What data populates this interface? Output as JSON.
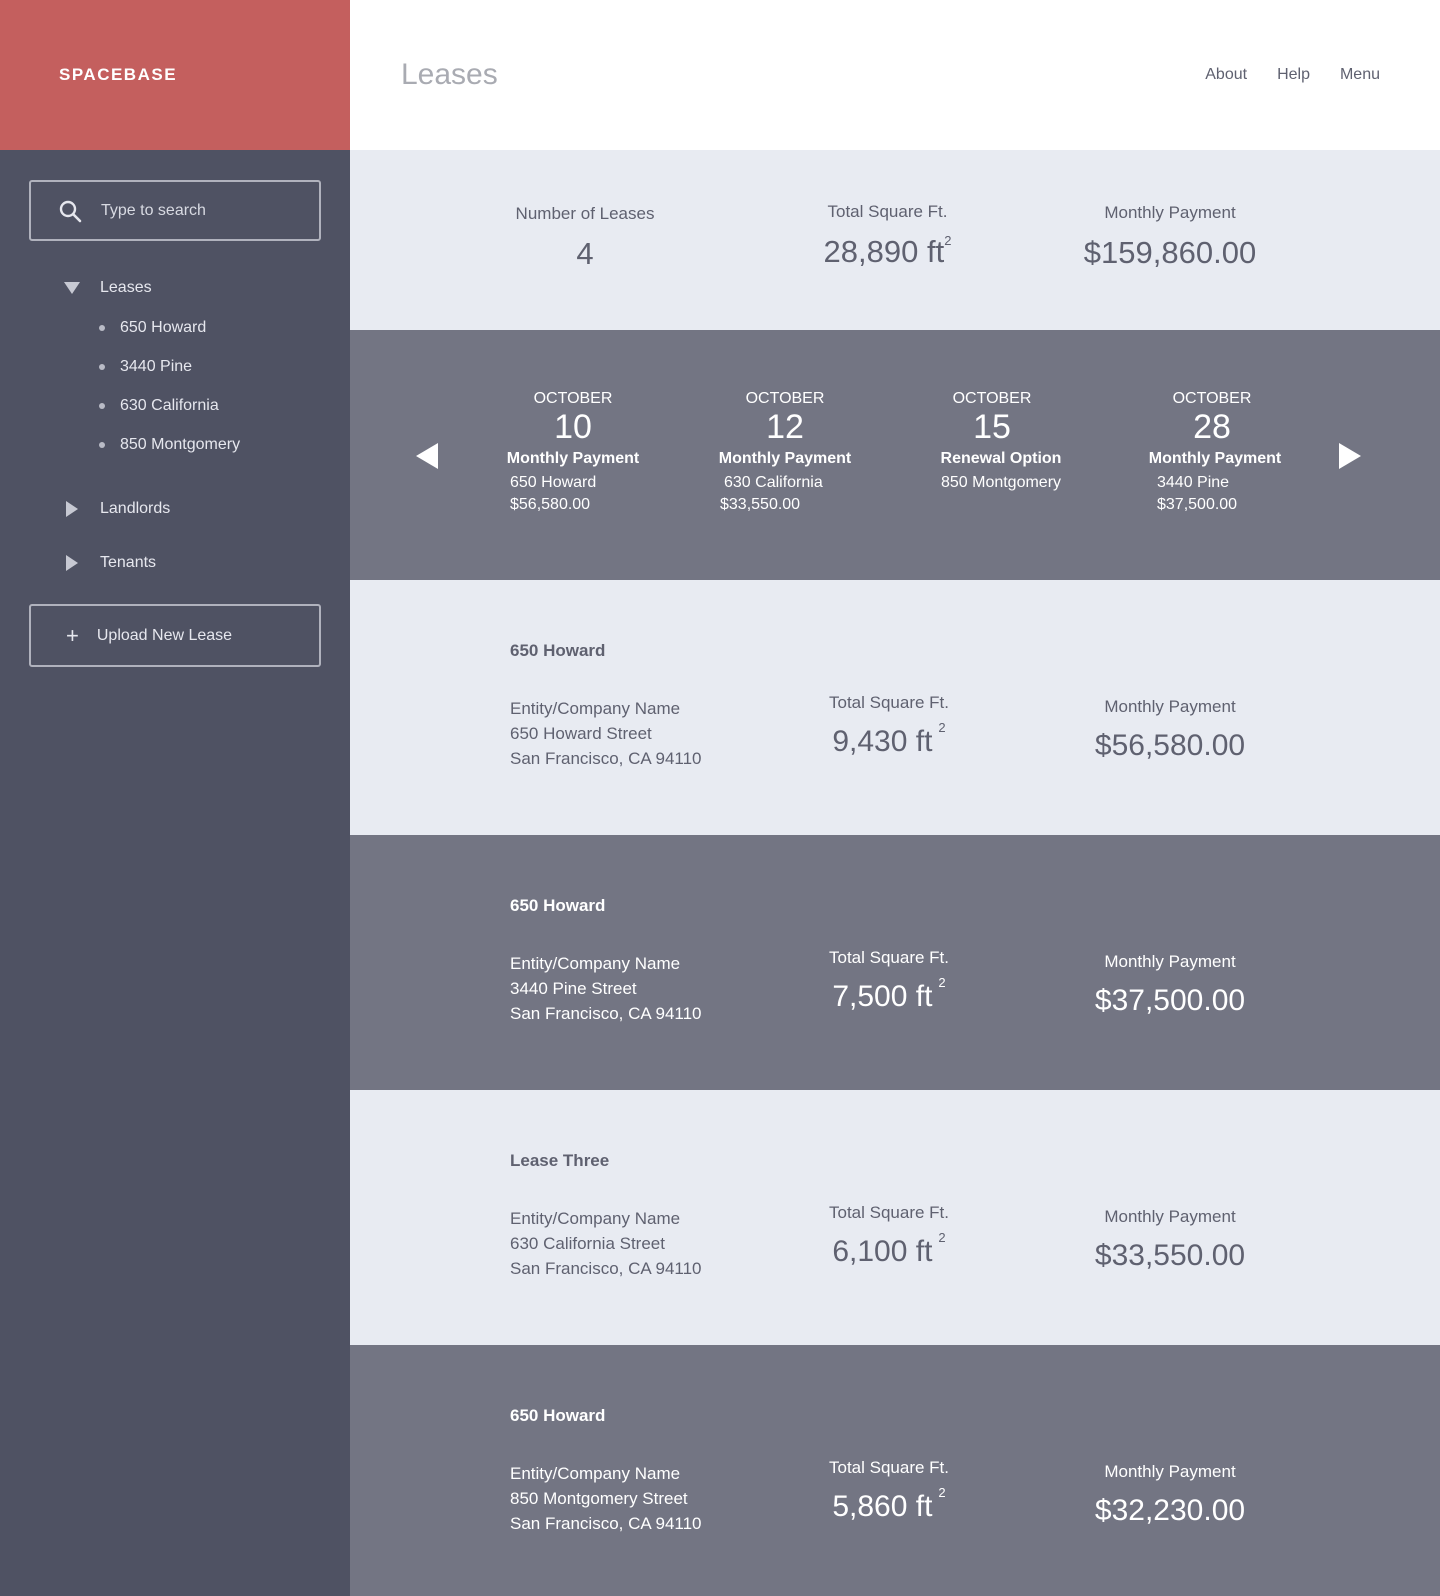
{
  "brand": "SPACEBASE",
  "search": {
    "placeholder": "Type to search"
  },
  "sidebar": {
    "leases_label": "Leases",
    "leases": [
      "650 Howard",
      "3440 Pine",
      "630 California",
      "850 Montgomery"
    ],
    "landlords_label": "Landlords",
    "tenants_label": "Tenants",
    "upload_label": "Upload New Lease"
  },
  "header": {
    "title": "Leases",
    "nav": [
      "About",
      "Help",
      "Menu"
    ]
  },
  "summary": {
    "count_label": "Number of Leases",
    "count_value": "4",
    "sqft_label": "Total Square Ft.",
    "sqft_value": "28,890 ft",
    "sqft_unit_exp": "2",
    "payment_label": "Monthly Payment",
    "payment_value": "$159,860.00"
  },
  "timeline": {
    "events": [
      {
        "month": "OCTOBER",
        "day": "10",
        "type": "Monthly Payment",
        "address": "650 Howard",
        "amount": "$56,580.00"
      },
      {
        "month": "OCTOBER",
        "day": "12",
        "type": "Monthly Payment",
        "address": "630 California",
        "amount": "$33,550.00"
      },
      {
        "month": "OCTOBER",
        "day": "15",
        "type": "Renewal Option",
        "address": "850 Montgomery",
        "amount": ""
      },
      {
        "month": "OCTOBER",
        "day": "28",
        "type": "Monthly Payment",
        "address": "3440 Pine",
        "amount": "$37,500.00"
      }
    ]
  },
  "leases": [
    {
      "name": "650 Howard",
      "entity": "Entity/Company Name",
      "street": "650 Howard Street",
      "city": "San Francisco, CA 94110",
      "sqft_label": "Total Square Ft.",
      "sqft": "9,430 ft",
      "exp": "2",
      "pay_label": "Monthly Payment",
      "payment": "$56,580.00"
    },
    {
      "name": "650 Howard",
      "entity": "Entity/Company Name",
      "street": "3440 Pine Street",
      "city": "San Francisco, CA 94110",
      "sqft_label": "Total Square Ft.",
      "sqft": "7,500 ft",
      "exp": "2",
      "pay_label": "Monthly Payment",
      "payment": "$37,500.00"
    },
    {
      "name": "Lease Three",
      "entity": "Entity/Company Name",
      "street": "630 California Street",
      "city": "San Francisco, CA 94110",
      "sqft_label": "Total Square Ft.",
      "sqft": "6,100 ft",
      "exp": "2",
      "pay_label": "Monthly Payment",
      "payment": "$33,550.00"
    },
    {
      "name": "650 Howard",
      "entity": "Entity/Company Name",
      "street": "850 Montgomery Street",
      "city": "San Francisco, CA 94110",
      "sqft_label": "Total Square Ft.",
      "sqft": "5,860 ft",
      "exp": "2",
      "pay_label": "Monthly Payment",
      "payment": "$32,230.00"
    }
  ],
  "colors": {
    "brand": "#c45f5e",
    "sidebar": "#4f5263",
    "band_light": "#e8ebf2",
    "band_dark": "#737583"
  },
  "icons": [
    "search-icon",
    "caret-down-icon",
    "caret-right-icon",
    "plus-icon",
    "arrow-left-icon",
    "arrow-right-icon"
  ]
}
